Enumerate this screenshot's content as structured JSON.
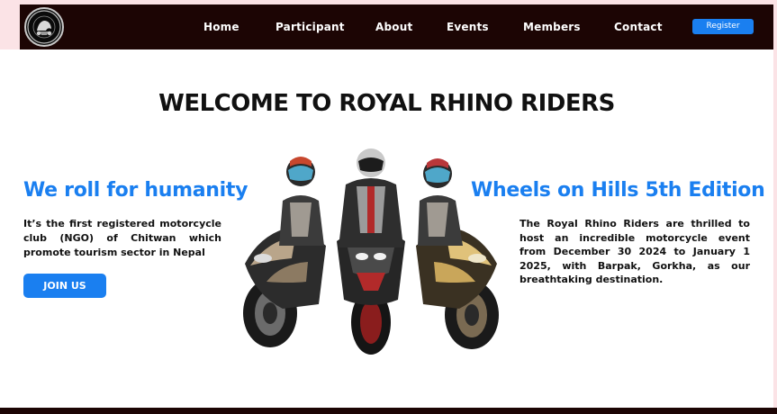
{
  "nav": {
    "logo_text": "Royal Rhino Riders",
    "links": [
      "Home",
      "Participant",
      "About",
      "Events",
      "Members",
      "Contact"
    ],
    "register_label": "Register"
  },
  "hero": {
    "title": "WELCOME TO ROYAL RHINO RIDERS",
    "left": {
      "heading": "We roll for humanity",
      "text": "It’s the first registered motorcycle club (NGO) of Chitwan which promote tourism sector in Nepal",
      "button_label": "JOIN US"
    },
    "right": {
      "heading": "Wheels on Hills 5th Edition",
      "text": "The Royal Rhino Riders are thrilled to host an incredible motorcycle event from December 30 2024 to January 1 2025, with Barpak, Gorkha, as our breathtaking destination."
    }
  },
  "colors": {
    "nav_bg": "#1c0504",
    "accent": "#1a7ff0",
    "page_edge": "#fbe3e6"
  },
  "icons": {
    "logo": "club-emblem",
    "hero": "three-riders-motorcycles-illustration"
  }
}
